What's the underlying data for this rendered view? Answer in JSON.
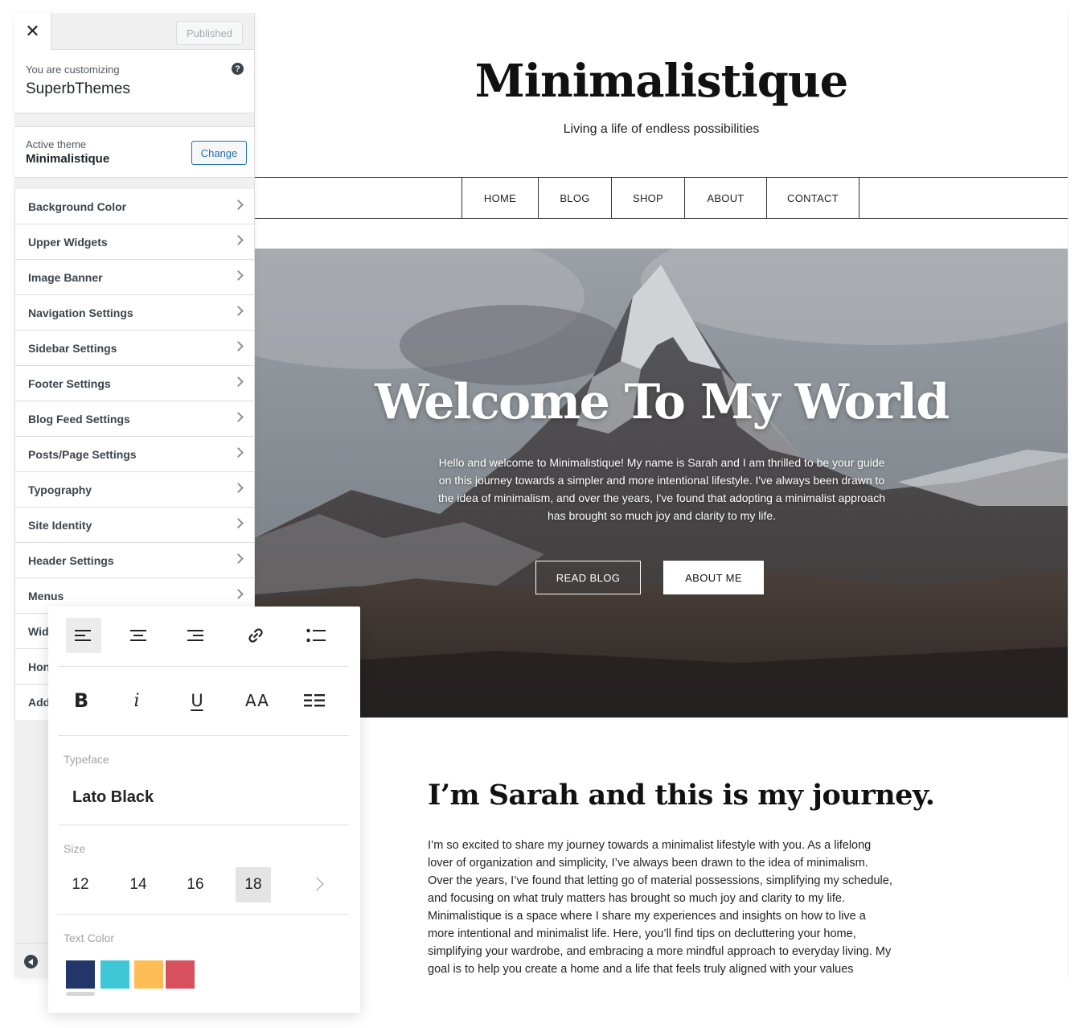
{
  "customizer": {
    "published_label": "Published",
    "customizing_label": "You are customizing",
    "site_name": "SuperbThemes",
    "active_theme_label": "Active theme",
    "active_theme_name": "Minimalistique",
    "change_label": "Change",
    "sections": [
      {
        "label": "Background Color"
      },
      {
        "label": "Upper Widgets"
      },
      {
        "label": "Image Banner"
      },
      {
        "label": "Navigation Settings"
      },
      {
        "label": "Sidebar Settings"
      },
      {
        "label": "Footer Settings"
      },
      {
        "label": "Blog Feed Settings"
      },
      {
        "label": "Posts/Page Settings"
      },
      {
        "label": "Typography"
      },
      {
        "label": "Site Identity"
      },
      {
        "label": "Header Settings"
      },
      {
        "label": "Menus"
      },
      {
        "label": "Wid"
      },
      {
        "label": "Hon"
      },
      {
        "label": "Add"
      }
    ]
  },
  "site": {
    "title": "Minimalistique",
    "tagline": "Living a life of endless possibilities",
    "nav": [
      {
        "label": "HOME"
      },
      {
        "label": "BLOG"
      },
      {
        "label": "SHOP"
      },
      {
        "label": "ABOUT"
      },
      {
        "label": "CONTACT"
      }
    ],
    "hero": {
      "title": "Welcome To My World",
      "text": "Hello and welcome to Minimalistique! My name is Sarah and I am thrilled to be your guide on this journey towards a simpler and more intentional lifestyle. I've always been drawn to the idea of minimalism, and over the years, I've found that adopting a minimalist approach has brought so much joy and clarity to my life.",
      "read_blog": "READ BLOG",
      "about_me": "ABOUT ME"
    },
    "about": {
      "heading": "I’m Sarah and this is my journey.",
      "text": "I’m so excited to share my journey towards a minimalist lifestyle with you. As a lifelong lover of organization and simplicity, I’ve always been drawn to the idea of minimalism. Over the years, I’ve found that letting go of material possessions, simplifying my schedule, and focusing on what truly matters has brought so much joy and clarity to my life. Minimalistique is a space where I share my experiences and insights on how to live a more intentional and minimalist life. Here, you’ll find tips on decluttering your home, simplifying your wardrobe, and embracing a more mindful approach to everyday living. My goal is to help you create a home and a life that feels truly aligned with your values"
    }
  },
  "typography_card": {
    "tools_row1": [
      "align-left-icon",
      "align-center-icon",
      "align-right-icon",
      "link-icon",
      "list-icon"
    ],
    "tools_row2": {
      "bold": "B",
      "italic": "i",
      "underline": "U",
      "caps": "AA"
    },
    "typeface_label": "Typeface",
    "typeface_value": "Lato Black",
    "size_label": "Size",
    "sizes": [
      "12",
      "14",
      "16",
      "18"
    ],
    "selected_size": "18",
    "text_color_label": "Text Color",
    "colors": [
      "#233669",
      "#3ec8d6",
      "#ffbd55",
      "#d6505e"
    ],
    "selected_color": "#233669"
  }
}
